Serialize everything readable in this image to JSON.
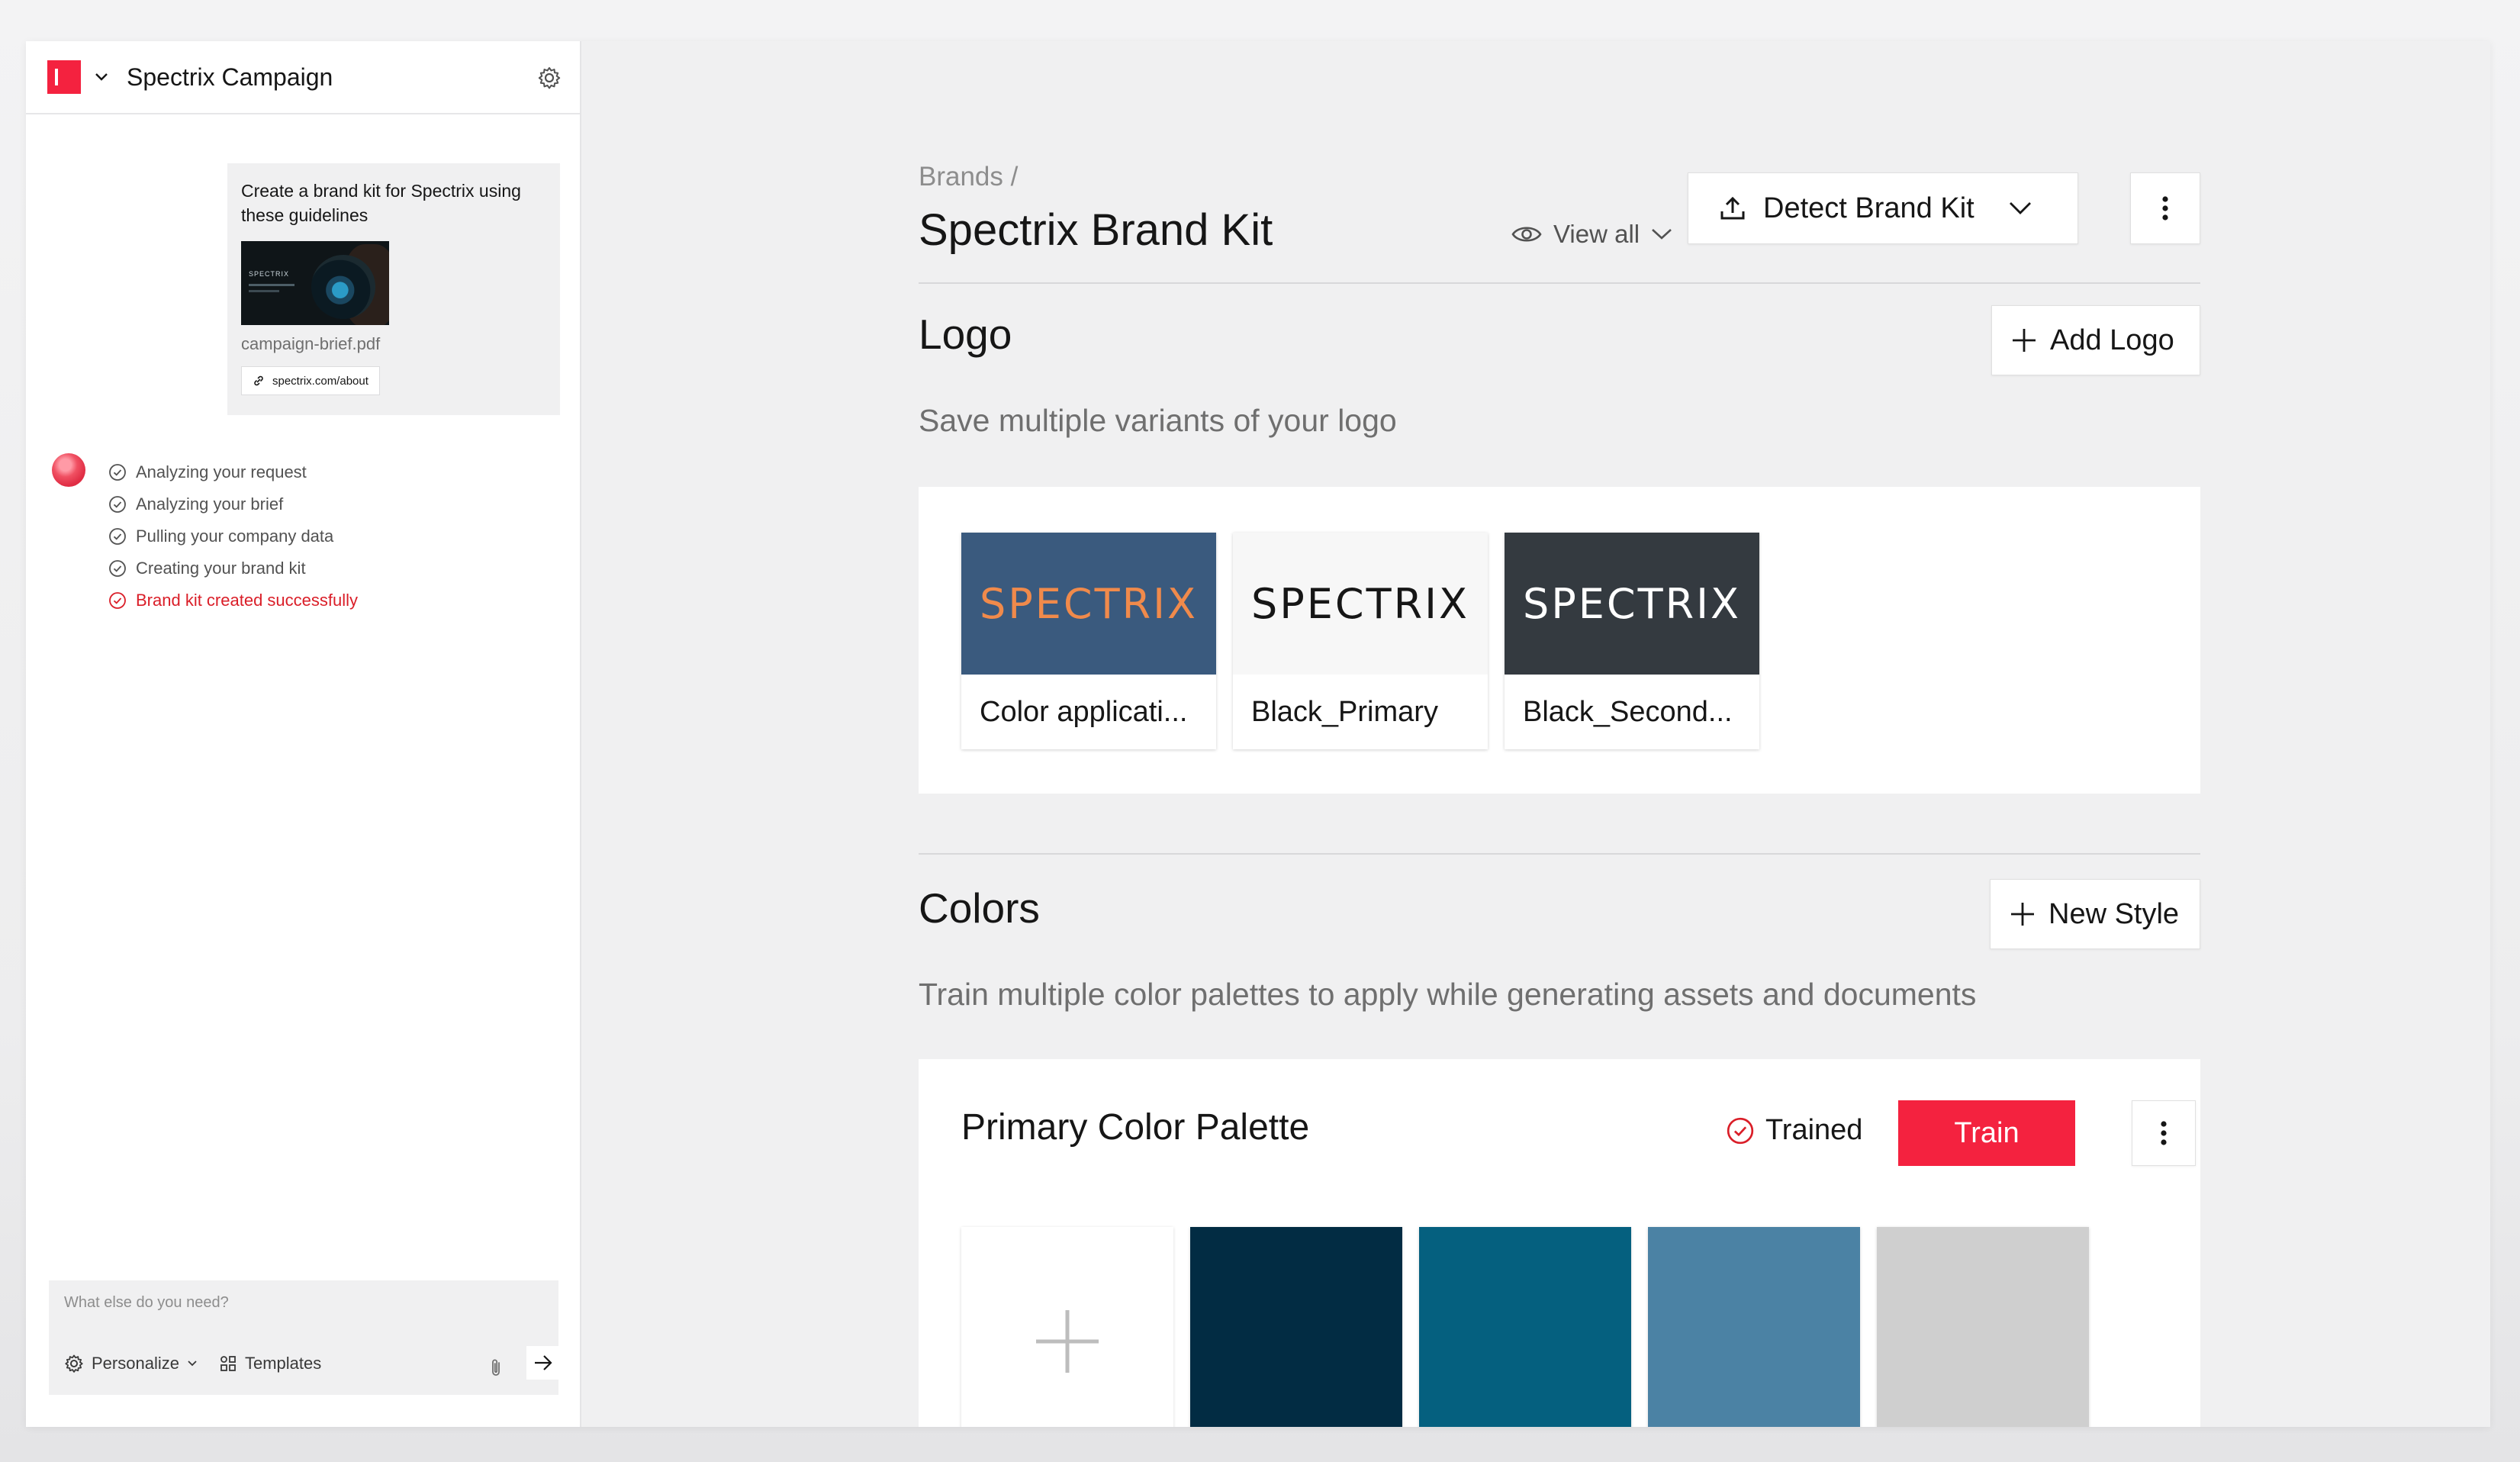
{
  "sidebar": {
    "project_title": "Spectrix Campaign",
    "message": {
      "text": "Create a brand kit for Spectrix using these guidelines",
      "thumbnail_text": "SPECTRIX",
      "file_name": "campaign-brief.pdf",
      "link": "spectrix.com/about"
    },
    "steps": [
      {
        "label": "Analyzing your request",
        "status": "done"
      },
      {
        "label": "Analyzing your brief",
        "status": "done"
      },
      {
        "label": "Pulling your company data",
        "status": "done"
      },
      {
        "label": "Creating your brand kit",
        "status": "done"
      },
      {
        "label": "Brand kit created successfully",
        "status": "success"
      }
    ],
    "composer": {
      "placeholder": "What else do you need?",
      "personalize_label": "Personalize",
      "templates_label": "Templates"
    }
  },
  "main": {
    "breadcrumb": "Brands /",
    "title": "Spectrix Brand Kit",
    "view_all_label": "View all",
    "detect_label": "Detect Brand Kit",
    "logo_section": {
      "title": "Logo",
      "add_label": "Add Logo",
      "description": "Save multiple variants of your logo",
      "logos": [
        {
          "wordmark": "SPECTRIX",
          "label": "Color applicati...",
          "bg": "#3a5a7e",
          "fg": "#f08a4b"
        },
        {
          "wordmark": "SPECTRIX",
          "label": "Black_Primary",
          "bg": "#f7f7f7",
          "fg": "#161616"
        },
        {
          "wordmark": "SPECTRIX",
          "label": "Black_Second...",
          "bg": "#343a40",
          "fg": "#ffffff"
        }
      ]
    },
    "colors_section": {
      "title": "Colors",
      "add_label": "New Style",
      "description": "Train multiple color palettes to apply while generating assets and documents",
      "palette": {
        "title": "Primary Color Palette",
        "trained_label": "Trained",
        "train_label": "Train",
        "swatches": [
          "#022c43",
          "#05607f",
          "#4b82a4",
          "#cfcfcf"
        ]
      }
    }
  },
  "colors": {
    "accent": "#f4223f",
    "success_text": "#da1e28"
  }
}
